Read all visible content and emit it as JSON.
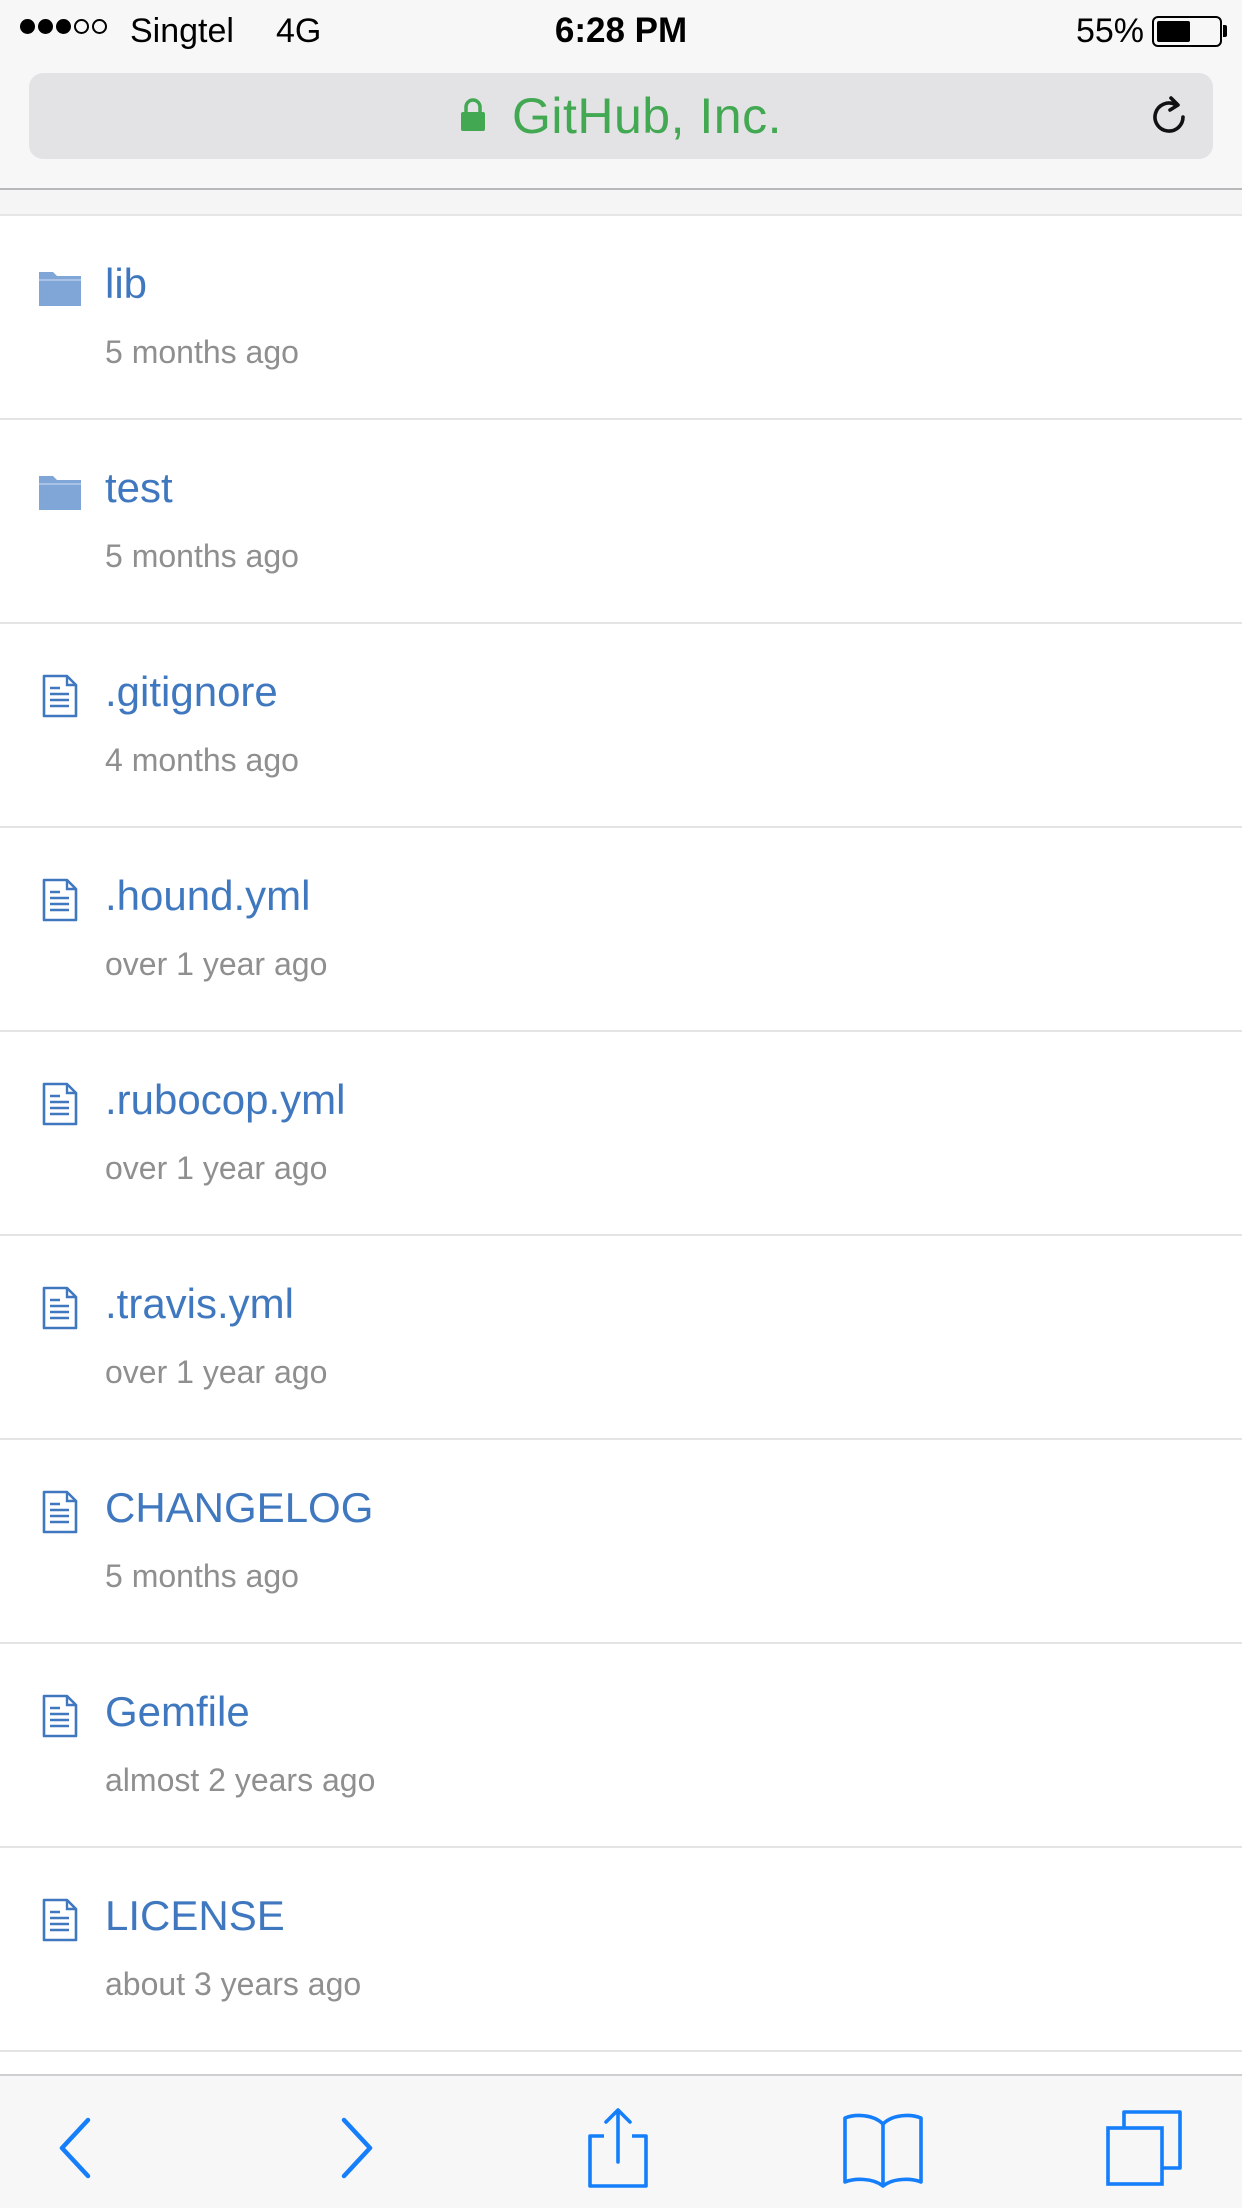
{
  "status_bar": {
    "carrier": "Singtel",
    "network": "4G",
    "time": "6:28 PM",
    "battery_percent": "55%",
    "battery_level": 0.55,
    "signal_bars_filled": 3,
    "signal_bars_total": 5
  },
  "url_bar": {
    "site_name": "GitHub, Inc.",
    "secure": true,
    "icons": {
      "lock": "lock-icon",
      "reload": "reload-icon"
    }
  },
  "colors": {
    "link": "#4078c0",
    "secure_green": "#42a852",
    "folder": "#7fa6d6",
    "ios_blue": "#147efb",
    "meta_gray": "#8f8f8f"
  },
  "files": [
    {
      "type": "folder",
      "icon": "folder-icon",
      "name": "lib",
      "age": "5 months ago"
    },
    {
      "type": "folder",
      "icon": "folder-icon",
      "name": "test",
      "age": "5 months ago"
    },
    {
      "type": "file",
      "icon": "file-icon",
      "name": ".gitignore",
      "age": "4 months ago"
    },
    {
      "type": "file",
      "icon": "file-icon",
      "name": ".hound.yml",
      "age": "over 1 year ago"
    },
    {
      "type": "file",
      "icon": "file-icon",
      "name": ".rubocop.yml",
      "age": "over 1 year ago"
    },
    {
      "type": "file",
      "icon": "file-icon",
      "name": ".travis.yml",
      "age": "over 1 year ago"
    },
    {
      "type": "file",
      "icon": "file-icon",
      "name": "CHANGELOG",
      "age": "5 months ago"
    },
    {
      "type": "file",
      "icon": "file-icon",
      "name": "Gemfile",
      "age": "almost 2 years ago"
    },
    {
      "type": "file",
      "icon": "file-icon",
      "name": "LICENSE",
      "age": "about 3 years ago"
    }
  ],
  "toolbar": {
    "buttons": [
      "back-icon",
      "forward-icon",
      "share-icon",
      "bookmarks-icon",
      "tabs-icon"
    ]
  }
}
